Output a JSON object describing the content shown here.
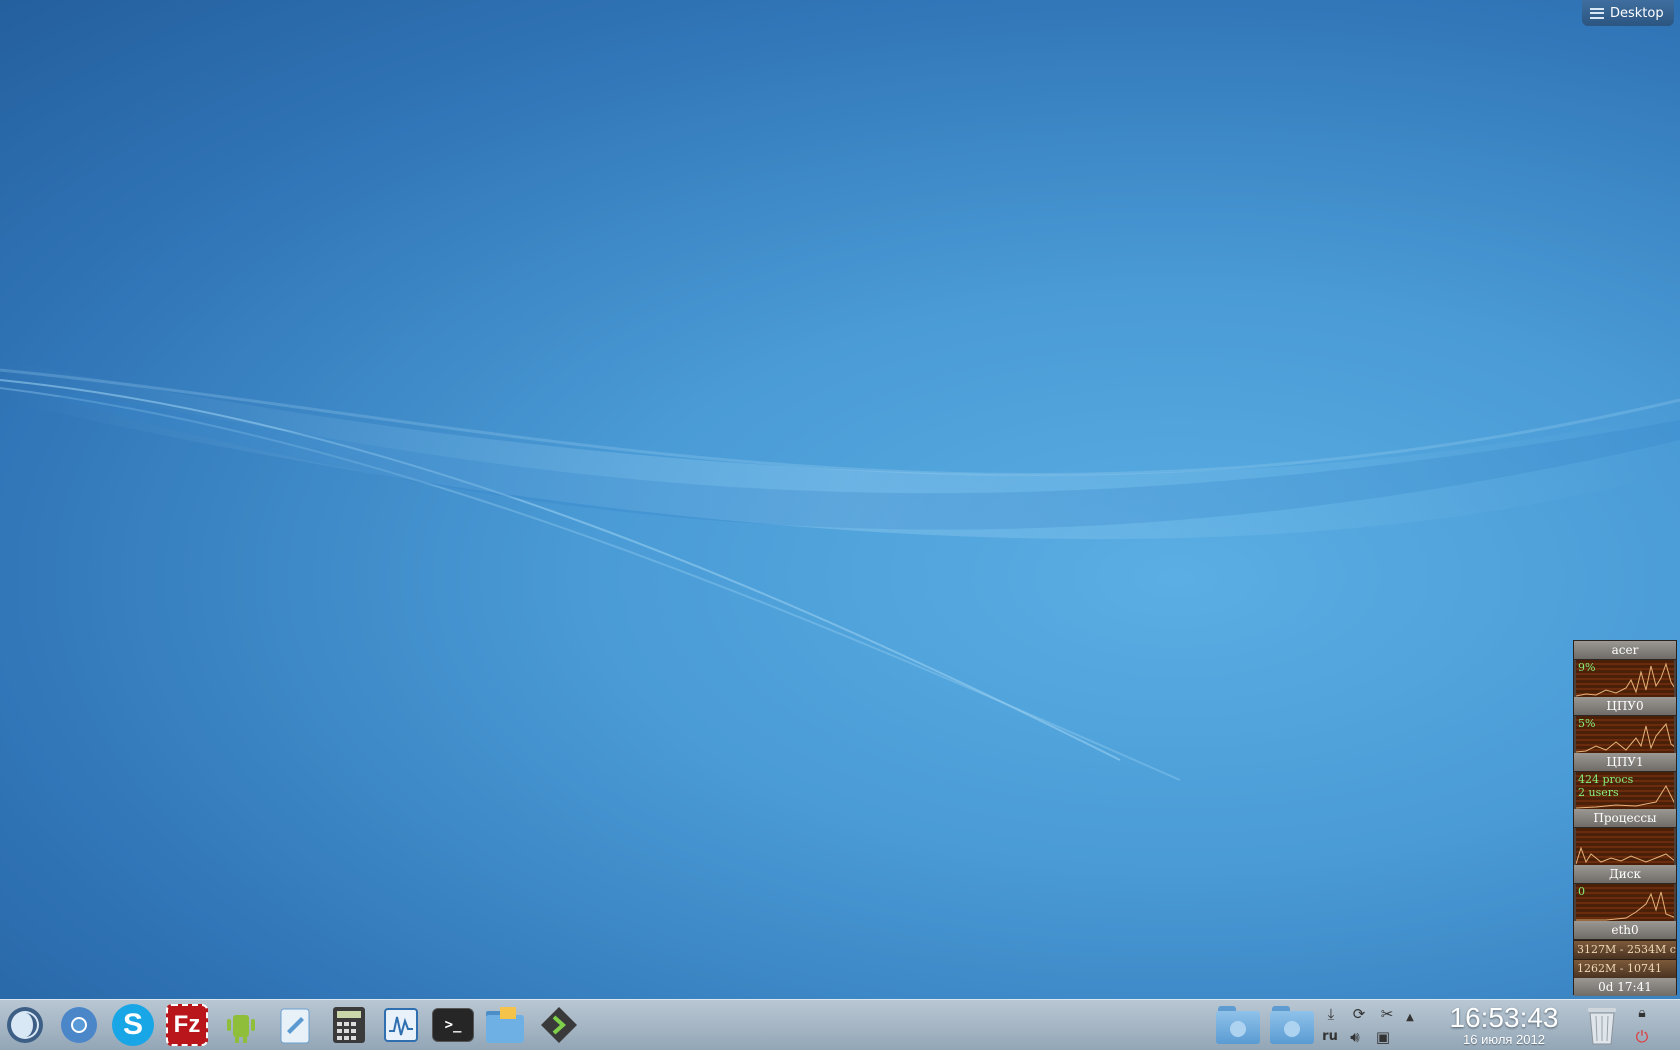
{
  "desktop_toolbox": {
    "label": "Desktop"
  },
  "system_monitor": {
    "host": "acer",
    "sections": [
      {
        "label": "ЦПУ0",
        "value": "9%"
      },
      {
        "label": "ЦПУ1",
        "value": "5%"
      },
      {
        "label": "Процессы",
        "value": "424 procs",
        "value2": "2 users"
      },
      {
        "label": "Диск",
        "value": ""
      },
      {
        "label": "eth0",
        "value": "0"
      }
    ],
    "memory_line": "3127M - 2534M c",
    "swap_line": "1262M - 10741",
    "uptime": "0d 17:41",
    "graph_color": "#e7b27a",
    "value_color": "#86f07a"
  },
  "taskbar": {
    "launchers": [
      {
        "name": "app-menu-icon"
      },
      {
        "name": "chromium-icon"
      },
      {
        "name": "skype-icon",
        "glyph": "S"
      },
      {
        "name": "filezilla-icon",
        "glyph": "Fz"
      },
      {
        "name": "android-sdk-icon"
      },
      {
        "name": "text-editor-icon"
      },
      {
        "name": "calculator-icon"
      },
      {
        "name": "system-monitor-icon"
      },
      {
        "name": "terminal-icon",
        "glyph": ">_"
      },
      {
        "name": "file-manager-icon"
      },
      {
        "name": "media-player-icon"
      }
    ],
    "tray": {
      "keyboard_layout": "ru",
      "clock_time": "16:53:43",
      "clock_date": "16 июля 2012"
    }
  }
}
